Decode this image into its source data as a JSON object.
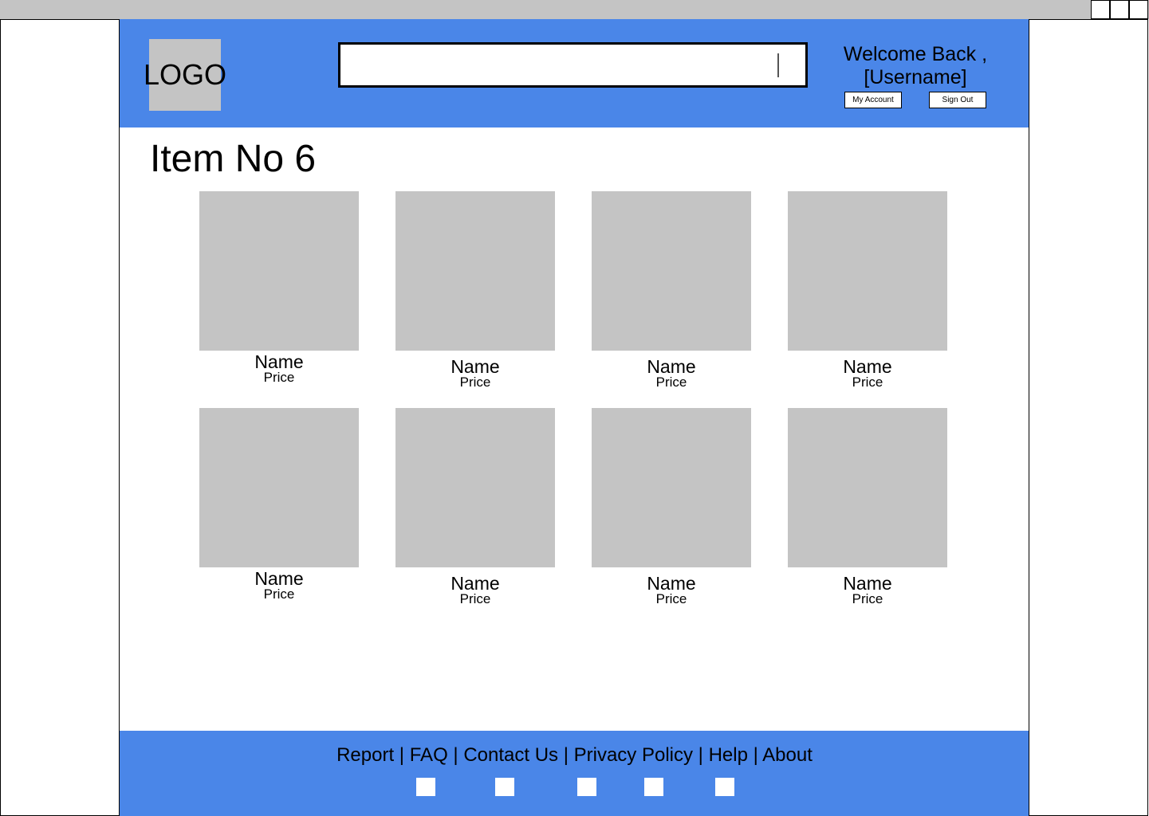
{
  "header": {
    "logo_text": "LOGO",
    "search": {
      "value": ""
    },
    "welcome_line1": "Welcome Back ,",
    "welcome_line2": "[Username]",
    "my_account_label": "My Account",
    "sign_out_label": "Sign Out"
  },
  "main": {
    "title": "Item No 6",
    "products": [
      {
        "name": "Name",
        "price": "Price"
      },
      {
        "name": "Name",
        "price": "Price"
      },
      {
        "name": "Name",
        "price": "Price"
      },
      {
        "name": "Name",
        "price": "Price"
      },
      {
        "name": "Name",
        "price": "Price"
      },
      {
        "name": "Name",
        "price": "Price"
      },
      {
        "name": "Name",
        "price": "Price"
      },
      {
        "name": "Name",
        "price": "Price"
      }
    ]
  },
  "footer": {
    "links": [
      "Report",
      "FAQ",
      "Contact Us",
      "Privacy Policy",
      "Help",
      "About"
    ],
    "separator": " | ",
    "social_icons": [
      "social-icon",
      "social-icon",
      "social-icon",
      "social-icon",
      "social-icon"
    ]
  },
  "colors": {
    "brand_blue": "#4a86e8",
    "placeholder_gray": "#c4c4c4"
  }
}
